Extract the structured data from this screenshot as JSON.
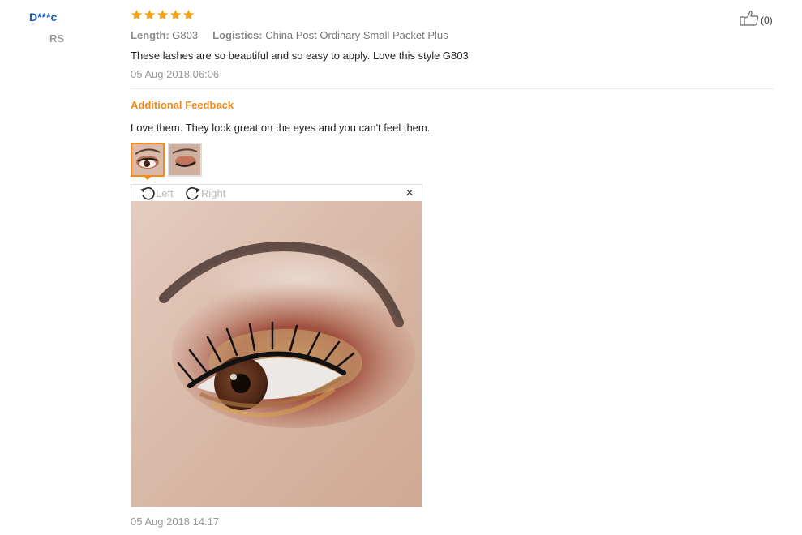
{
  "review": {
    "user_name": "D***c",
    "country": "RS",
    "rating": 5,
    "rating_max": 5,
    "length_label": "Length:",
    "length_value": "G803",
    "logistics_label": "Logistics:",
    "logistics_value": "China Post Ordinary Small Packet Plus",
    "text": "These lashes are so beautiful and so easy to apply. Love this style G803",
    "date": "05 Aug 2018 06:06",
    "helpful_count": "(0)"
  },
  "additional": {
    "title": "Additional Feedback",
    "text": "Love them. They look great on the eyes and you can't feel them.",
    "date": "05 Aug 2018 14:17"
  },
  "viewer": {
    "rotate_left_label": "Left",
    "rotate_right_label": "Right",
    "close_glyph": "×"
  },
  "colors": {
    "star": "#f5a21b",
    "accent": "#f08a1c",
    "username": "#1a5fb4"
  },
  "icons": {
    "helpful": "thumbs-up-icon",
    "rotate_left": "rotate-left-icon",
    "rotate_right": "rotate-right-icon",
    "close": "close-icon",
    "star": "star-icon"
  }
}
